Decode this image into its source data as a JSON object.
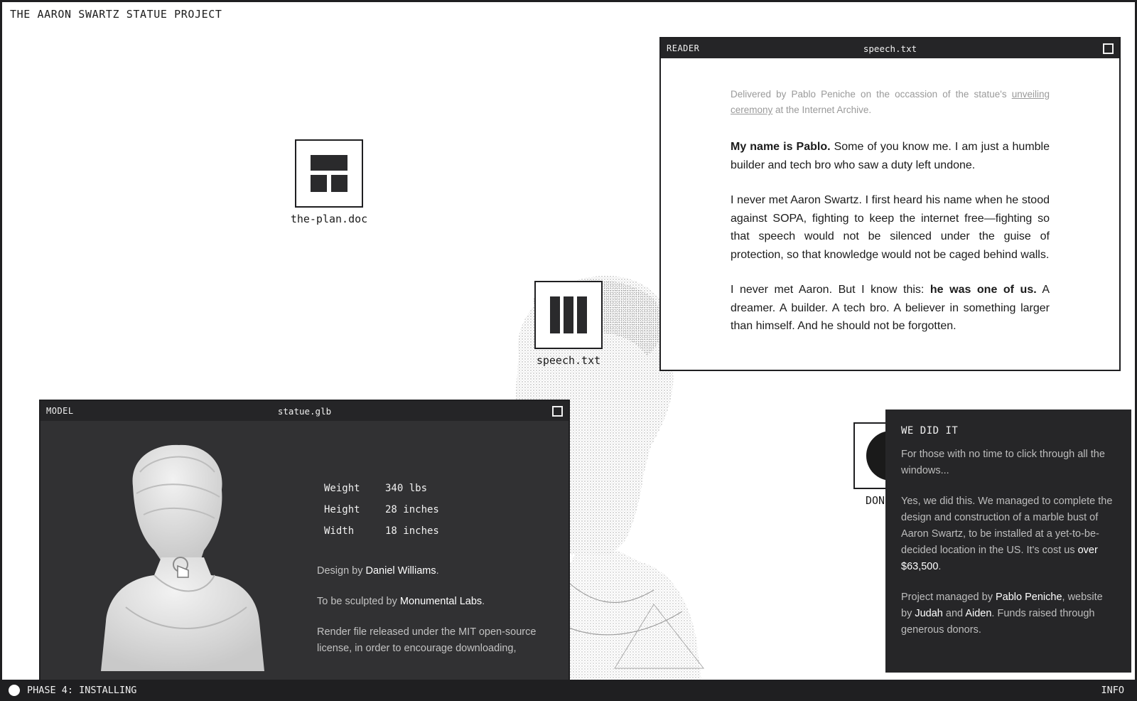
{
  "site": {
    "title": "THE AARON SWARTZ STATUE PROJECT"
  },
  "icons": [
    {
      "label": "the-plan.doc",
      "icon": "grid-icon"
    },
    {
      "label": "speech.txt",
      "icon": "bars-icon"
    },
    {
      "label": "DON",
      "icon": "circle-icon"
    }
  ],
  "reader": {
    "type": "READER",
    "file": "speech.txt",
    "intro_before": "Delivered by Pablo Peniche on the occassion of the statue's ",
    "intro_link": "unveiling ceremony",
    "intro_after": " at the Internet Archive.",
    "p1_bold": "My name is Pablo.",
    "p1_rest": " Some of you know me. I am just a humble builder and tech bro who saw a duty left undone.",
    "p2": "I never met Aaron Swartz. I first heard his name when he stood against SOPA, fighting to keep the internet free—fighting so that speech would not be silenced under the guise of protection, so that knowledge would not be caged behind walls.",
    "p3_a": "I never met Aaron. But I know this: ",
    "p3_bold": "he was one of us.",
    "p3_b": " A dreamer. A builder. A tech bro. A believer in something larger than himself. And he should not be forgotten."
  },
  "model": {
    "type": "MODEL",
    "file": "statue.glb",
    "specs": [
      {
        "key": "Weight",
        "value": "340 lbs"
      },
      {
        "key": "Height",
        "value": "28 inches"
      },
      {
        "key": "Width",
        "value": "18 inches"
      }
    ],
    "design_prefix": "Design by ",
    "designer": "Daniel Williams",
    "design_suffix": ".",
    "sculpt_prefix": "To be sculpted by ",
    "sculptor": "Monumental Labs",
    "sculpt_suffix": ".",
    "render_note": "Render file released under the MIT open-source license, in order to encourage downloading,"
  },
  "info": {
    "title": "WE DID IT",
    "p1": "For those with no time to click through all the windows...",
    "p2_a": "Yes, we did this. We managed to complete the design and construction of a marble bust of Aaron Swartz, to be installed at a yet-to-be-decided location in the US. It's cost us ",
    "p2_amount": "over $63,500",
    "p2_b": ".",
    "p3_a": "Project managed by ",
    "p3_manager": "Pablo Peniche",
    "p3_b": ", website by ",
    "p3_dev1": "Judah",
    "p3_c": " and ",
    "p3_dev2": "Aiden",
    "p3_d": ". Funds raised through generous donors."
  },
  "status": {
    "phase": "PHASE 4: INSTALLING",
    "info_button": "INFO"
  }
}
